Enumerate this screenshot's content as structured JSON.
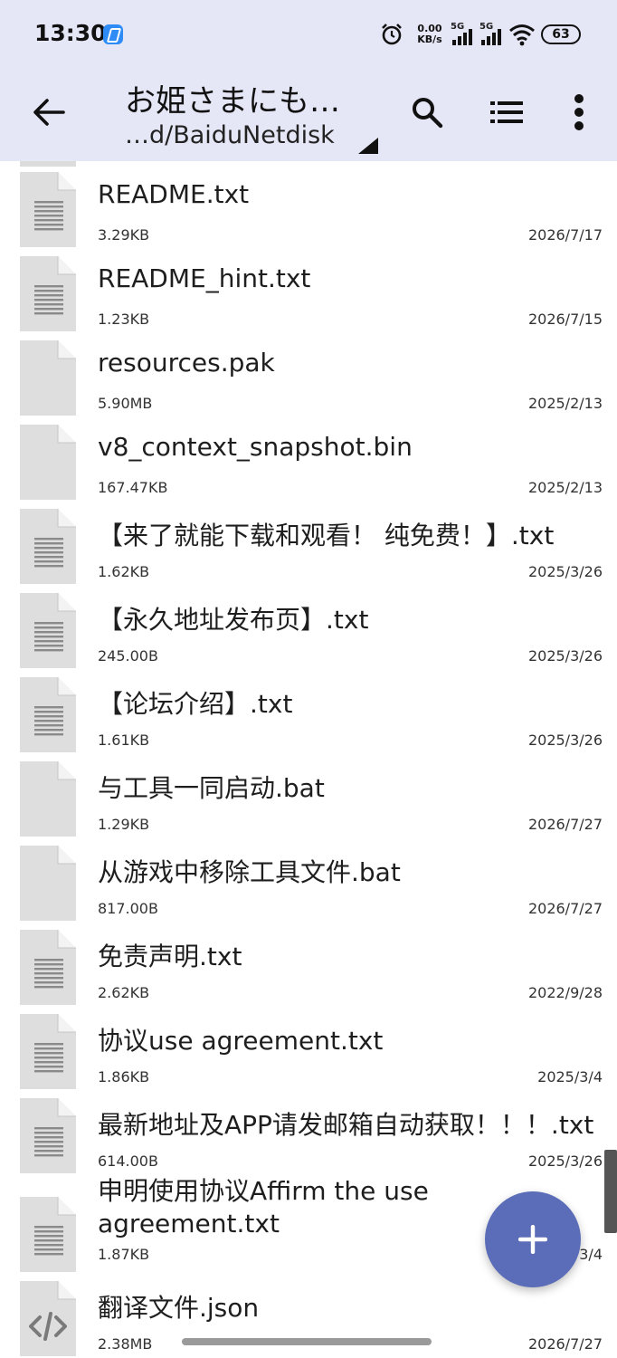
{
  "status_bar": {
    "time": "13:30",
    "net_speed_value": "0.00",
    "net_speed_unit": "KB/s",
    "signal1_label": "5G",
    "signal2_label": "5G",
    "battery": "63"
  },
  "app_bar": {
    "title": "お姫さまにも…",
    "path": "…d/BaiduNetdisk"
  },
  "files": [
    {
      "name": "README.txt",
      "size": "3.29KB",
      "date": "2026/7/17",
      "icon": "text-file-icon"
    },
    {
      "name": "README_hint.txt",
      "size": "1.23KB",
      "date": "2026/7/15",
      "icon": "text-file-icon"
    },
    {
      "name": "resources.pak",
      "size": "5.90MB",
      "date": "2025/2/13",
      "icon": "blank-file-icon"
    },
    {
      "name": "v8_context_snapshot.bin",
      "size": "167.47KB",
      "date": "2025/2/13",
      "icon": "blank-file-icon"
    },
    {
      "name": "【来了就能下载和观看！ 纯免费！】.txt",
      "size": "1.62KB",
      "date": "2025/3/26",
      "icon": "text-file-icon"
    },
    {
      "name": "【永久地址发布页】.txt",
      "size": "245.00B",
      "date": "2025/3/26",
      "icon": "text-file-icon"
    },
    {
      "name": "【论坛介绍】.txt",
      "size": "1.61KB",
      "date": "2025/3/26",
      "icon": "text-file-icon"
    },
    {
      "name": "与工具一同启动.bat",
      "size": "1.29KB",
      "date": "2026/7/27",
      "icon": "blank-file-icon"
    },
    {
      "name": "从游戏中移除工具文件.bat",
      "size": "817.00B",
      "date": "2026/7/27",
      "icon": "blank-file-icon"
    },
    {
      "name": "免责声明.txt",
      "size": "2.62KB",
      "date": "2022/9/28",
      "icon": "text-file-icon"
    },
    {
      "name": "协议use agreement.txt",
      "size": "1.86KB",
      "date": "2025/3/4",
      "icon": "text-file-icon"
    },
    {
      "name": "最新地址及APP请发邮箱自动获取！！！.txt",
      "size": "614.00B",
      "date": "2025/3/26",
      "icon": "text-file-icon"
    },
    {
      "name": "申明使用协议Affirm the use agreement.txt",
      "size": "1.87KB",
      "date": "2025/3/4",
      "icon": "text-file-icon"
    },
    {
      "name": "翻译文件.json",
      "size": "2.38MB",
      "date": "2026/7/27",
      "icon": "code-file-icon"
    }
  ],
  "fab": {
    "icon": "plus-icon"
  },
  "colors": {
    "app_bar_bg": "#e6e7f6",
    "fab_bg": "#5b6db8",
    "file_icon": "#dedede"
  }
}
